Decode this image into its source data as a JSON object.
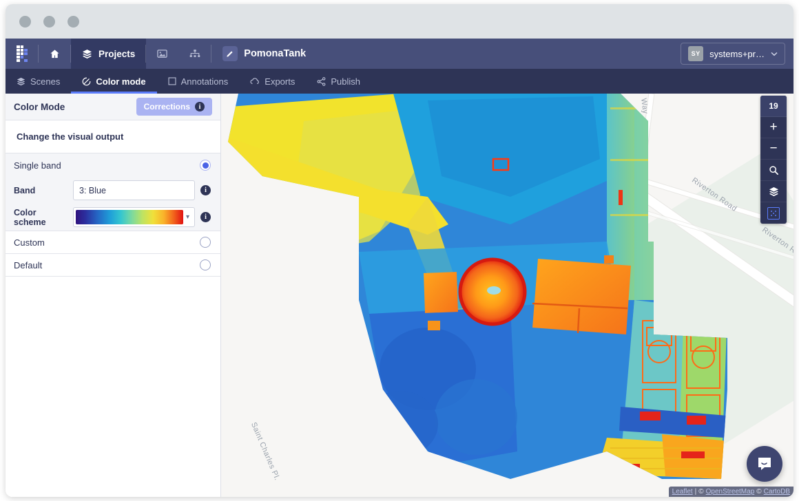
{
  "window": {
    "traffic_lights": 3
  },
  "topnav": {
    "logo": "relabs-logo-icon",
    "home_label": "",
    "projects_label": "Projects",
    "project_name": "PomonaTank",
    "user": {
      "initials": "SY",
      "name": "systems+pr…"
    }
  },
  "subnav": {
    "tabs": [
      {
        "label": "Scenes",
        "icon": "layers-icon",
        "active": false
      },
      {
        "label": "Color mode",
        "icon": "color-mode-icon",
        "active": true
      },
      {
        "label": "Annotations",
        "icon": "annotation-icon",
        "active": false
      },
      {
        "label": "Exports",
        "icon": "export-cloud-icon",
        "active": false
      },
      {
        "label": "Publish",
        "icon": "share-icon",
        "active": false
      }
    ]
  },
  "sidebar": {
    "panel_title": "Color Mode",
    "corrections_label": "Corrections",
    "subtitle": "Change the visual output",
    "modes": [
      {
        "label": "Single band",
        "selected": true
      },
      {
        "label": "Custom",
        "selected": false
      },
      {
        "label": "Default",
        "selected": false
      }
    ],
    "band": {
      "label": "Band",
      "value": "3: Blue"
    },
    "color_scheme": {
      "label": "Color scheme",
      "value": "spectral-rainbow",
      "stops": [
        "#30137f",
        "#2565c4",
        "#1f9fd8",
        "#35c6cf",
        "#bde363",
        "#f0e03a",
        "#f9b22a",
        "#e11212"
      ]
    },
    "info_glyph": "i"
  },
  "map": {
    "zoom_level": "19",
    "controls": [
      {
        "name": "zoom-in",
        "glyph": "+"
      },
      {
        "name": "zoom-out",
        "glyph": "−"
      },
      {
        "name": "search",
        "glyph": "search-icon"
      },
      {
        "name": "layers",
        "glyph": "layers-icon"
      },
      {
        "name": "select-area",
        "glyph": "select-area-icon"
      }
    ],
    "road_labels": [
      {
        "text": "Way"
      },
      {
        "text": "Riverton Road"
      },
      {
        "text": "Riverton Ro"
      },
      {
        "text": "Saint Charles Pl."
      }
    ],
    "attribution": {
      "leaflet": "Leaflet",
      "sep": "|",
      "osm_prefix": "©",
      "osm": "OpenStreetMap",
      "carto_prefix": "©",
      "carto": "CartoDB"
    },
    "intercom_label": "messenger-icon"
  },
  "colors": {
    "nav_bg": "#474f7a",
    "subnav_bg": "#2e3456",
    "accent": "#5b7cfa",
    "corrections_bg": "#aab3f2"
  }
}
